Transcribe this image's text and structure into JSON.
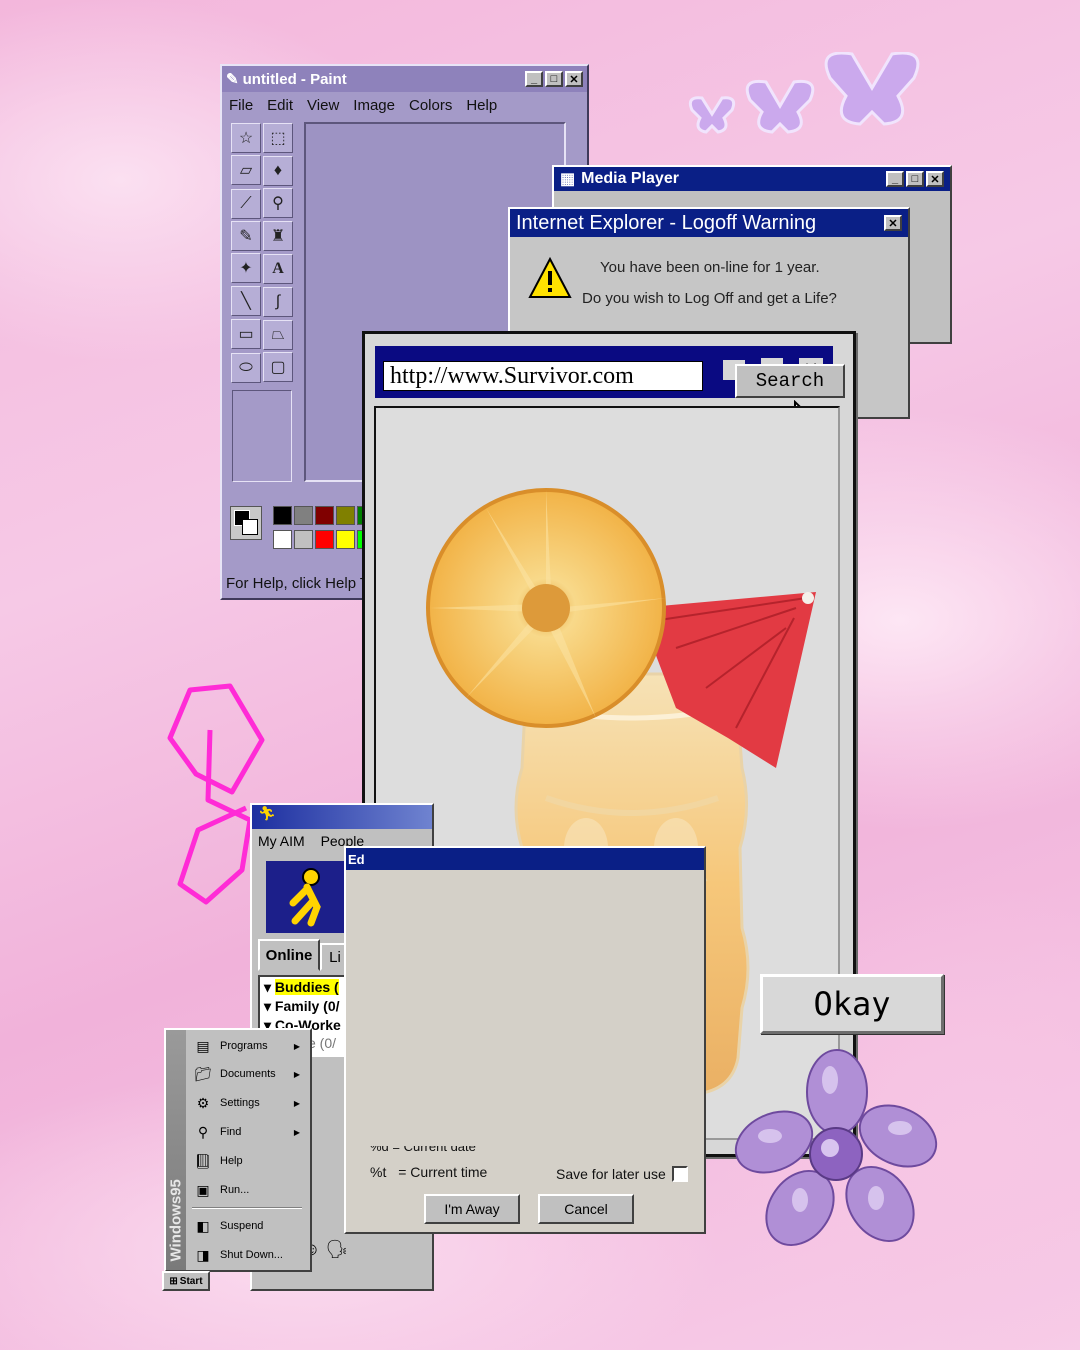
{
  "paint": {
    "title": "untitled - Paint",
    "menu": [
      "File",
      "Edit",
      "View",
      "Image",
      "Colors",
      "Help"
    ],
    "status": "For Help, click Help T"
  },
  "media_player": {
    "title": "Media Player"
  },
  "ie_warning": {
    "title": "Internet Explorer - Logoff Warning",
    "line1": "You have been on-line for 1 year.",
    "line2": "Do you wish to Log Off and get a Life?"
  },
  "browser": {
    "url": "http://www.Survivor.com",
    "search_label": "Search"
  },
  "okay_label": "Okay",
  "aim": {
    "menu_my_aim": "My AIM",
    "menu_people": "People",
    "tab_online": "Online",
    "tab_list": "Li",
    "groups": [
      "Buddies (",
      "Family (0/",
      "Co-Worke",
      "e (0/"
    ]
  },
  "away_dialog": {
    "title": "Ed",
    "line_date": "%d = Current date",
    "line_time_code": "%t",
    "line_time": "= Current time",
    "save_label": "Save for later use",
    "away_button": "I'm Away",
    "cancel_button": "Cancel"
  },
  "start_menu": {
    "brand": "Windows95",
    "items": [
      "Programs",
      "Documents",
      "Settings",
      "Find",
      "Help",
      "Run...",
      "Suspend",
      "Shut Down..."
    ],
    "start_label": "Start"
  },
  "colors": {
    "titlebar_blue": "#0a1f86",
    "paint_lavender": "#a49ac8",
    "doodle_magenta": "#ff2bd6"
  }
}
